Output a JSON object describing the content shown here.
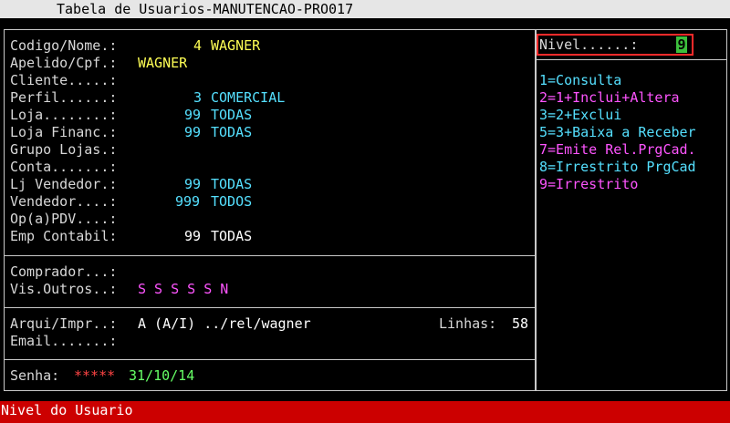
{
  "window": {
    "title": "Tabela de Usuarios-MANUTENCAO-PRO017"
  },
  "form": {
    "codigo_nome": {
      "label": "Codigo/Nome.:",
      "code": "4",
      "name": "WAGNER"
    },
    "apelido_cpf": {
      "label": "Apelido/Cpf.:",
      "value": "WAGNER"
    },
    "cliente": {
      "label": "Cliente.....:"
    },
    "perfil": {
      "label": "Perfil......:",
      "code": "3",
      "name": "COMERCIAL"
    },
    "loja": {
      "label": "Loja........:",
      "code": "99",
      "name": "TODAS"
    },
    "loja_financ": {
      "label": "Loja Financ.:",
      "code": "99",
      "name": "TODAS"
    },
    "grupo_lojas": {
      "label": "Grupo Lojas.:"
    },
    "conta": {
      "label": "Conta.......:"
    },
    "lj_vendedor": {
      "label": "Lj Vendedor.:",
      "code": "99",
      "name": "TODAS"
    },
    "vendedor": {
      "label": "Vendedor....:",
      "code": "999",
      "name": "TODOS"
    },
    "op_pdv": {
      "label": "Op(a)PDV....:"
    },
    "emp_contabil": {
      "label": "Emp Contabil:",
      "code": "99",
      "name": "TODAS"
    },
    "comprador": {
      "label": "Comprador...:"
    },
    "vis_outros": {
      "label": "Vis.Outros..:",
      "value": "S S S S S N"
    },
    "arqui_impr": {
      "label": "Arqui/Impr..:",
      "value": "A (A/I) ../rel/wagner"
    },
    "linhas": {
      "label": "Linhas:",
      "value": "58"
    },
    "email": {
      "label": "Email.......:"
    },
    "senha": {
      "label": "Senha:",
      "value": "*****",
      "date": "31/10/14"
    }
  },
  "nivel": {
    "label": "Nivel......:",
    "value": "9",
    "options": [
      {
        "text": "1=Consulta",
        "color": "#55e0ff"
      },
      {
        "text": "2=1+Inclui+Altera",
        "color": "#ff55ff"
      },
      {
        "text": "3=2+Exclui",
        "color": "#55e0ff"
      },
      {
        "text": "5=3+Baixa a Receber",
        "color": "#55e0ff"
      },
      {
        "text": "7=Emite Rel.PrgCad.",
        "color": "#ff55ff"
      },
      {
        "text": "8=Irrestrito PrgCad",
        "color": "#55e0ff"
      },
      {
        "text": "9=Irrestrito",
        "color": "#ff55ff"
      }
    ]
  },
  "status": {
    "message": "Nivel do Usuario"
  }
}
